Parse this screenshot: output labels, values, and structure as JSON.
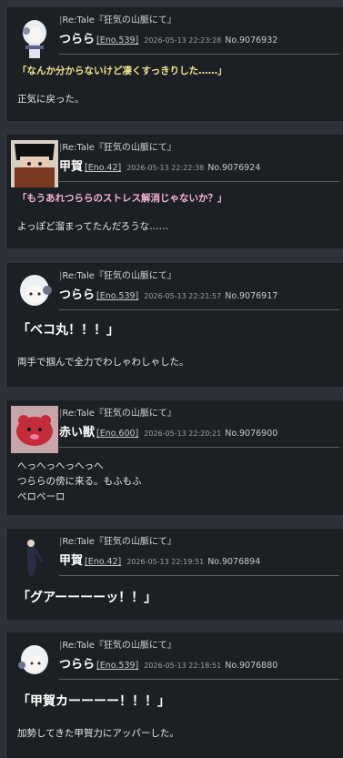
{
  "posts": [
    {
      "location": "Re:Tale『狂気の山脈にて』",
      "name": "つらら",
      "eno": "[Eno.539]",
      "date": "2026-05-13 22:23:28",
      "no": "No.9076932",
      "speech": "「なんか分からないけど凄くすっきりした……」",
      "text": [
        "正気に戻った。"
      ]
    },
    {
      "location": "Re:Tale『狂気の山脈にて』",
      "name": "甲賀",
      "eno": "[Eno.42]",
      "date": "2026-05-13 22:22:38",
      "no": "No.9076924",
      "speech": "「もうあれつららのストレス解消じゃないか？」",
      "text": [
        "よっぽど溜まってたんだろうな……"
      ]
    },
    {
      "location": "Re:Tale『狂気の山脈にて』",
      "name": "つらら",
      "eno": "[Eno.539]",
      "date": "2026-05-13 22:21:57",
      "no": "No.9076917",
      "speech": "「ベコ丸！！！」",
      "text": [
        "両手で掴んで全力でわしゃわしゃした。"
      ]
    },
    {
      "location": "Re:Tale『狂気の山脈にて』",
      "name": "赤い獣",
      "eno": "[Eno.600]",
      "date": "2026-05-13 22:20:21",
      "no": "No.9076900",
      "speech": "",
      "text": [
        "へっへっへっへっへ",
        "つららの傍に来る。もふもふ",
        "ペロペーロ"
      ]
    },
    {
      "location": "Re:Tale『狂気の山脈にて』",
      "name": "甲賀",
      "eno": "[Eno.42]",
      "date": "2026-05-13 22:19:51",
      "no": "No.9076894",
      "speech": "「グアーーーーッ！！」",
      "text": []
    },
    {
      "location": "Re:Tale『狂気の山脈にて』",
      "name": "つらら",
      "eno": "[Eno.539]",
      "date": "2026-05-13 22:18:51",
      "no": "No.9076880",
      "speech": "「甲賀カーーーー！！！」",
      "text": [
        "加勢してきた甲賀力にアッパーした。"
      ]
    }
  ],
  "colors": {
    "background": "#2c3238",
    "post_background": "#1c2024",
    "speech_pink": "#f7b4d9",
    "speech_yellow": "#f3e48c"
  }
}
